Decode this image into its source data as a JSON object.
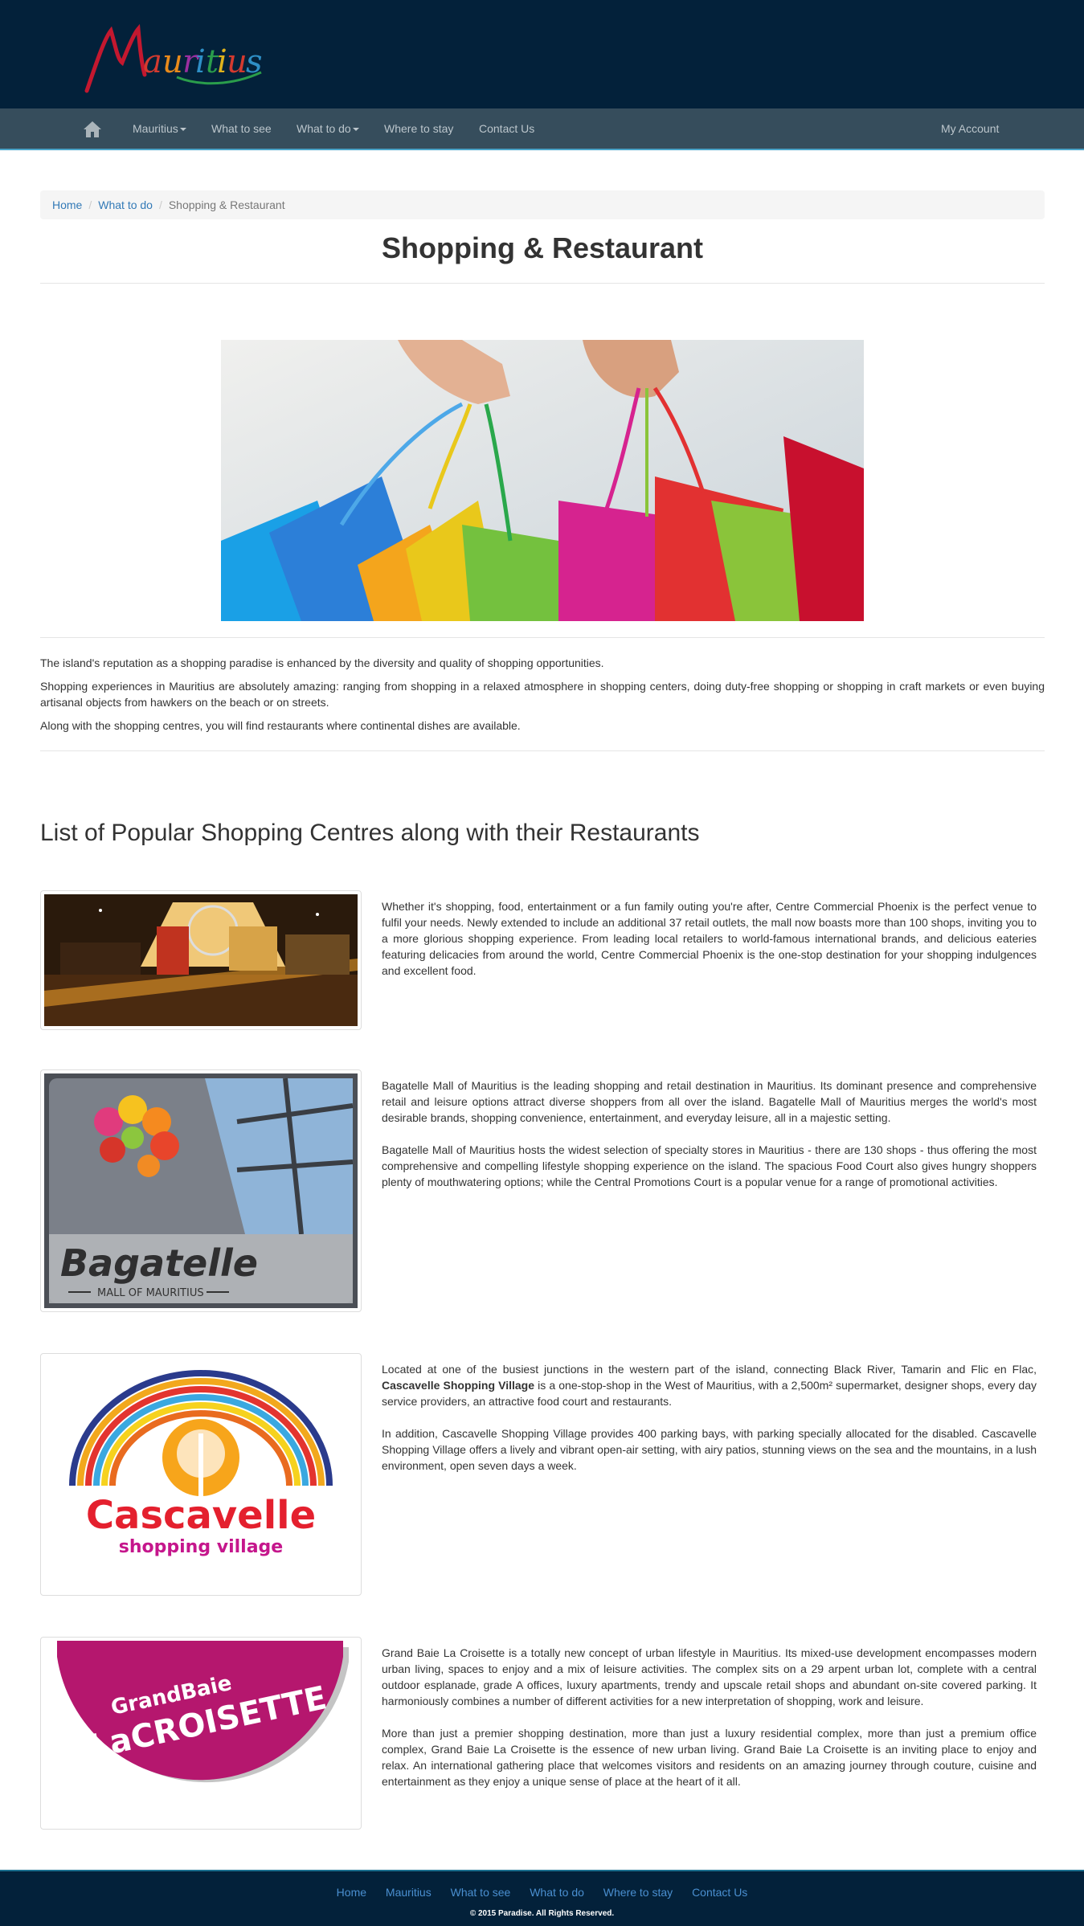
{
  "logo_text": "Mauritius",
  "nav": {
    "home_icon": "home-icon",
    "items": [
      "Mauritius",
      "What to see",
      "What to do",
      "Where to stay",
      "Contact Us"
    ],
    "account": "My Account"
  },
  "breadcrumb": [
    "Home",
    "What to do",
    "Shopping & Restaurant"
  ],
  "page_title": "Shopping & Restaurant",
  "intro": [
    "The island's reputation as a shopping paradise is enhanced by the diversity and quality of shopping opportunities.",
    "Shopping experiences in Mauritius are absolutely amazing: ranging from shopping in a relaxed atmosphere in shopping centers, doing duty-free shopping or shopping in craft markets or even buying artisanal objects from hawkers on the beach or on streets.",
    "Along with the shopping centres, you will find restaurants where continental dishes are available."
  ],
  "section_title": "List of Popular Shopping Centres along with their Restaurants",
  "centres": {
    "phoenix": {
      "p1": "Whether it's shopping, food, entertainment or a fun family outing you're after, Centre Commercial Phoenix is the perfect venue to fulfil your needs. Newly extended to include an additional 37 retail outlets, the mall now boasts more than 100 shops, inviting you to a more glorious shopping experience. From leading local retailers to world-famous international brands, and delicious eateries featuring delicacies from around the world, Centre Commercial Phoenix is the one-stop destination for your shopping indulgences and excellent food."
    },
    "bagatelle": {
      "logo_name": "Bagatelle",
      "logo_sub": "MALL OF MAURITIUS",
      "p1": "Bagatelle Mall of Mauritius is the leading shopping and retail destination in Mauritius. Its dominant presence and comprehensive retail and leisure options attract diverse shoppers from all over the island. Bagatelle Mall of Mauritius merges the world's most desirable brands, shopping convenience, entertainment, and everyday leisure, all in a majestic setting.",
      "p2": "Bagatelle Mall of Mauritius hosts the widest selection of specialty stores in Mauritius - there are 130 shops - thus offering the most comprehensive and compelling lifestyle shopping experience on the island. The spacious Food Court also gives hungry shoppers plenty of mouthwatering options; while the Central Promotions Court is a popular venue for a range of promotional activities."
    },
    "cascavelle": {
      "logo_name": "Cascavelle",
      "logo_sub": "shopping village",
      "p1_a": "Located at one of the busiest junctions in the western part of the island, connecting Black River, Tamarin and Flic en Flac, ",
      "p1_b": "Cascavelle Shopping Village",
      "p1_c": " is a one-stop-shop in the West of Mauritius, with a 2,500m² supermarket, designer shops, every day service providers, an attractive food court and restaurants.",
      "p2": "In addition, Cascavelle Shopping Village provides 400 parking bays, with parking specially allocated for the disabled. Cascavelle Shopping Village offers a lively and vibrant open-air setting, with airy patios, stunning views on the sea and the mountains, in a lush environment, open seven days a week."
    },
    "croisette": {
      "logo_line1": "GrandBaie",
      "logo_line2": "LaCROISETTE",
      "p1": "Grand Baie La Croisette is a totally new concept of urban lifestyle in Mauritius. Its mixed-use development encompasses modern urban living, spaces to enjoy and a mix of leisure activities. The complex sits on a 29 arpent urban lot, complete with a central outdoor esplanade, grade A offices, luxury apartments, trendy and upscale retail shops and abundant on-site covered parking. It harmoniously combines a number of different activities for a new interpretation of shopping, work and leisure.",
      "p2": "More than just a premier shopping destination, more than just a luxury residential complex, more than just a premium office complex, Grand Baie La Croisette is the essence of new urban living. Grand Baie La Croisette is an inviting place to enjoy and relax. An international gathering place that welcomes visitors and residents on an amazing journey through couture, cuisine and entertainment as they enjoy a unique sense of place at the heart of it all."
    }
  },
  "footer": {
    "links": [
      "Home",
      "Mauritius",
      "What to see",
      "What to do",
      "Where to stay",
      "Contact Us"
    ],
    "copyright": "© 2015 Paradise. All Rights Reserved."
  },
  "colors": {
    "header_bg": "#03213a",
    "nav_bg": "#364d5c",
    "link": "#337ab7"
  }
}
